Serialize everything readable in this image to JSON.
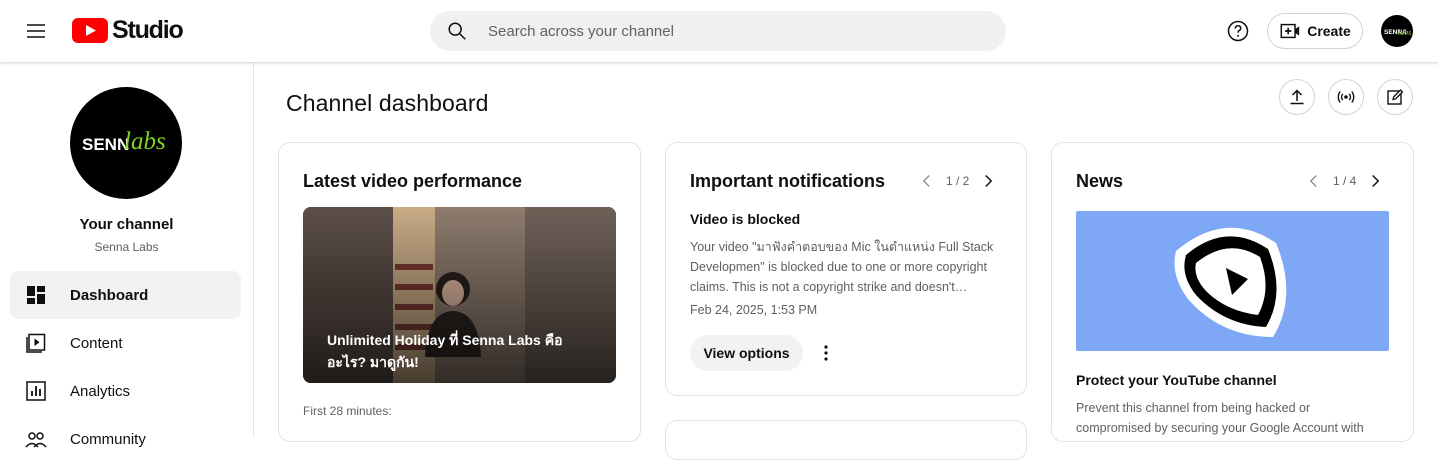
{
  "header": {
    "logo_text": "Studio",
    "search_placeholder": "Search across your channel",
    "create_label": "Create",
    "avatar_text": "SENNAlabs"
  },
  "sidebar": {
    "avatar_text_main": "SENN",
    "avatar_text_script": "labs",
    "channel_title": "Your channel",
    "channel_name": "Senna Labs",
    "items": [
      {
        "label": "Dashboard",
        "icon": "dashboard-icon",
        "active": true
      },
      {
        "label": "Content",
        "icon": "content-icon",
        "active": false
      },
      {
        "label": "Analytics",
        "icon": "analytics-icon",
        "active": false
      },
      {
        "label": "Community",
        "icon": "community-icon",
        "active": false
      }
    ]
  },
  "main": {
    "title": "Channel dashboard",
    "latest_video": {
      "title": "Latest video performance",
      "video_title": "Unlimited Holiday ที่ Senna Labs คืออะไร? มาดูกัน!",
      "first_minutes": "First 28 minutes:"
    },
    "notifications": {
      "title": "Important notifications",
      "pager": "1 / 2",
      "item_title": "Video is blocked",
      "item_body": "Your video \"มาฟังคำตอบของ Mic ในตำแหน่ง Full Stack Developmen\" is blocked due to one or more copyright claims. This is not a copyright strike and doesn't…",
      "item_date": "Feb 24, 2025, 1:53 PM",
      "view_options": "View options"
    },
    "news": {
      "title": "News",
      "pager": "1 / 4",
      "item_title": "Protect your YouTube channel",
      "item_body": "Prevent this channel from being hacked or compromised by securing your Google Account with"
    }
  },
  "colors": {
    "youtube_red": "#ff0000",
    "accent_green": "#7ed321",
    "news_blue": "#7ea8f5"
  }
}
